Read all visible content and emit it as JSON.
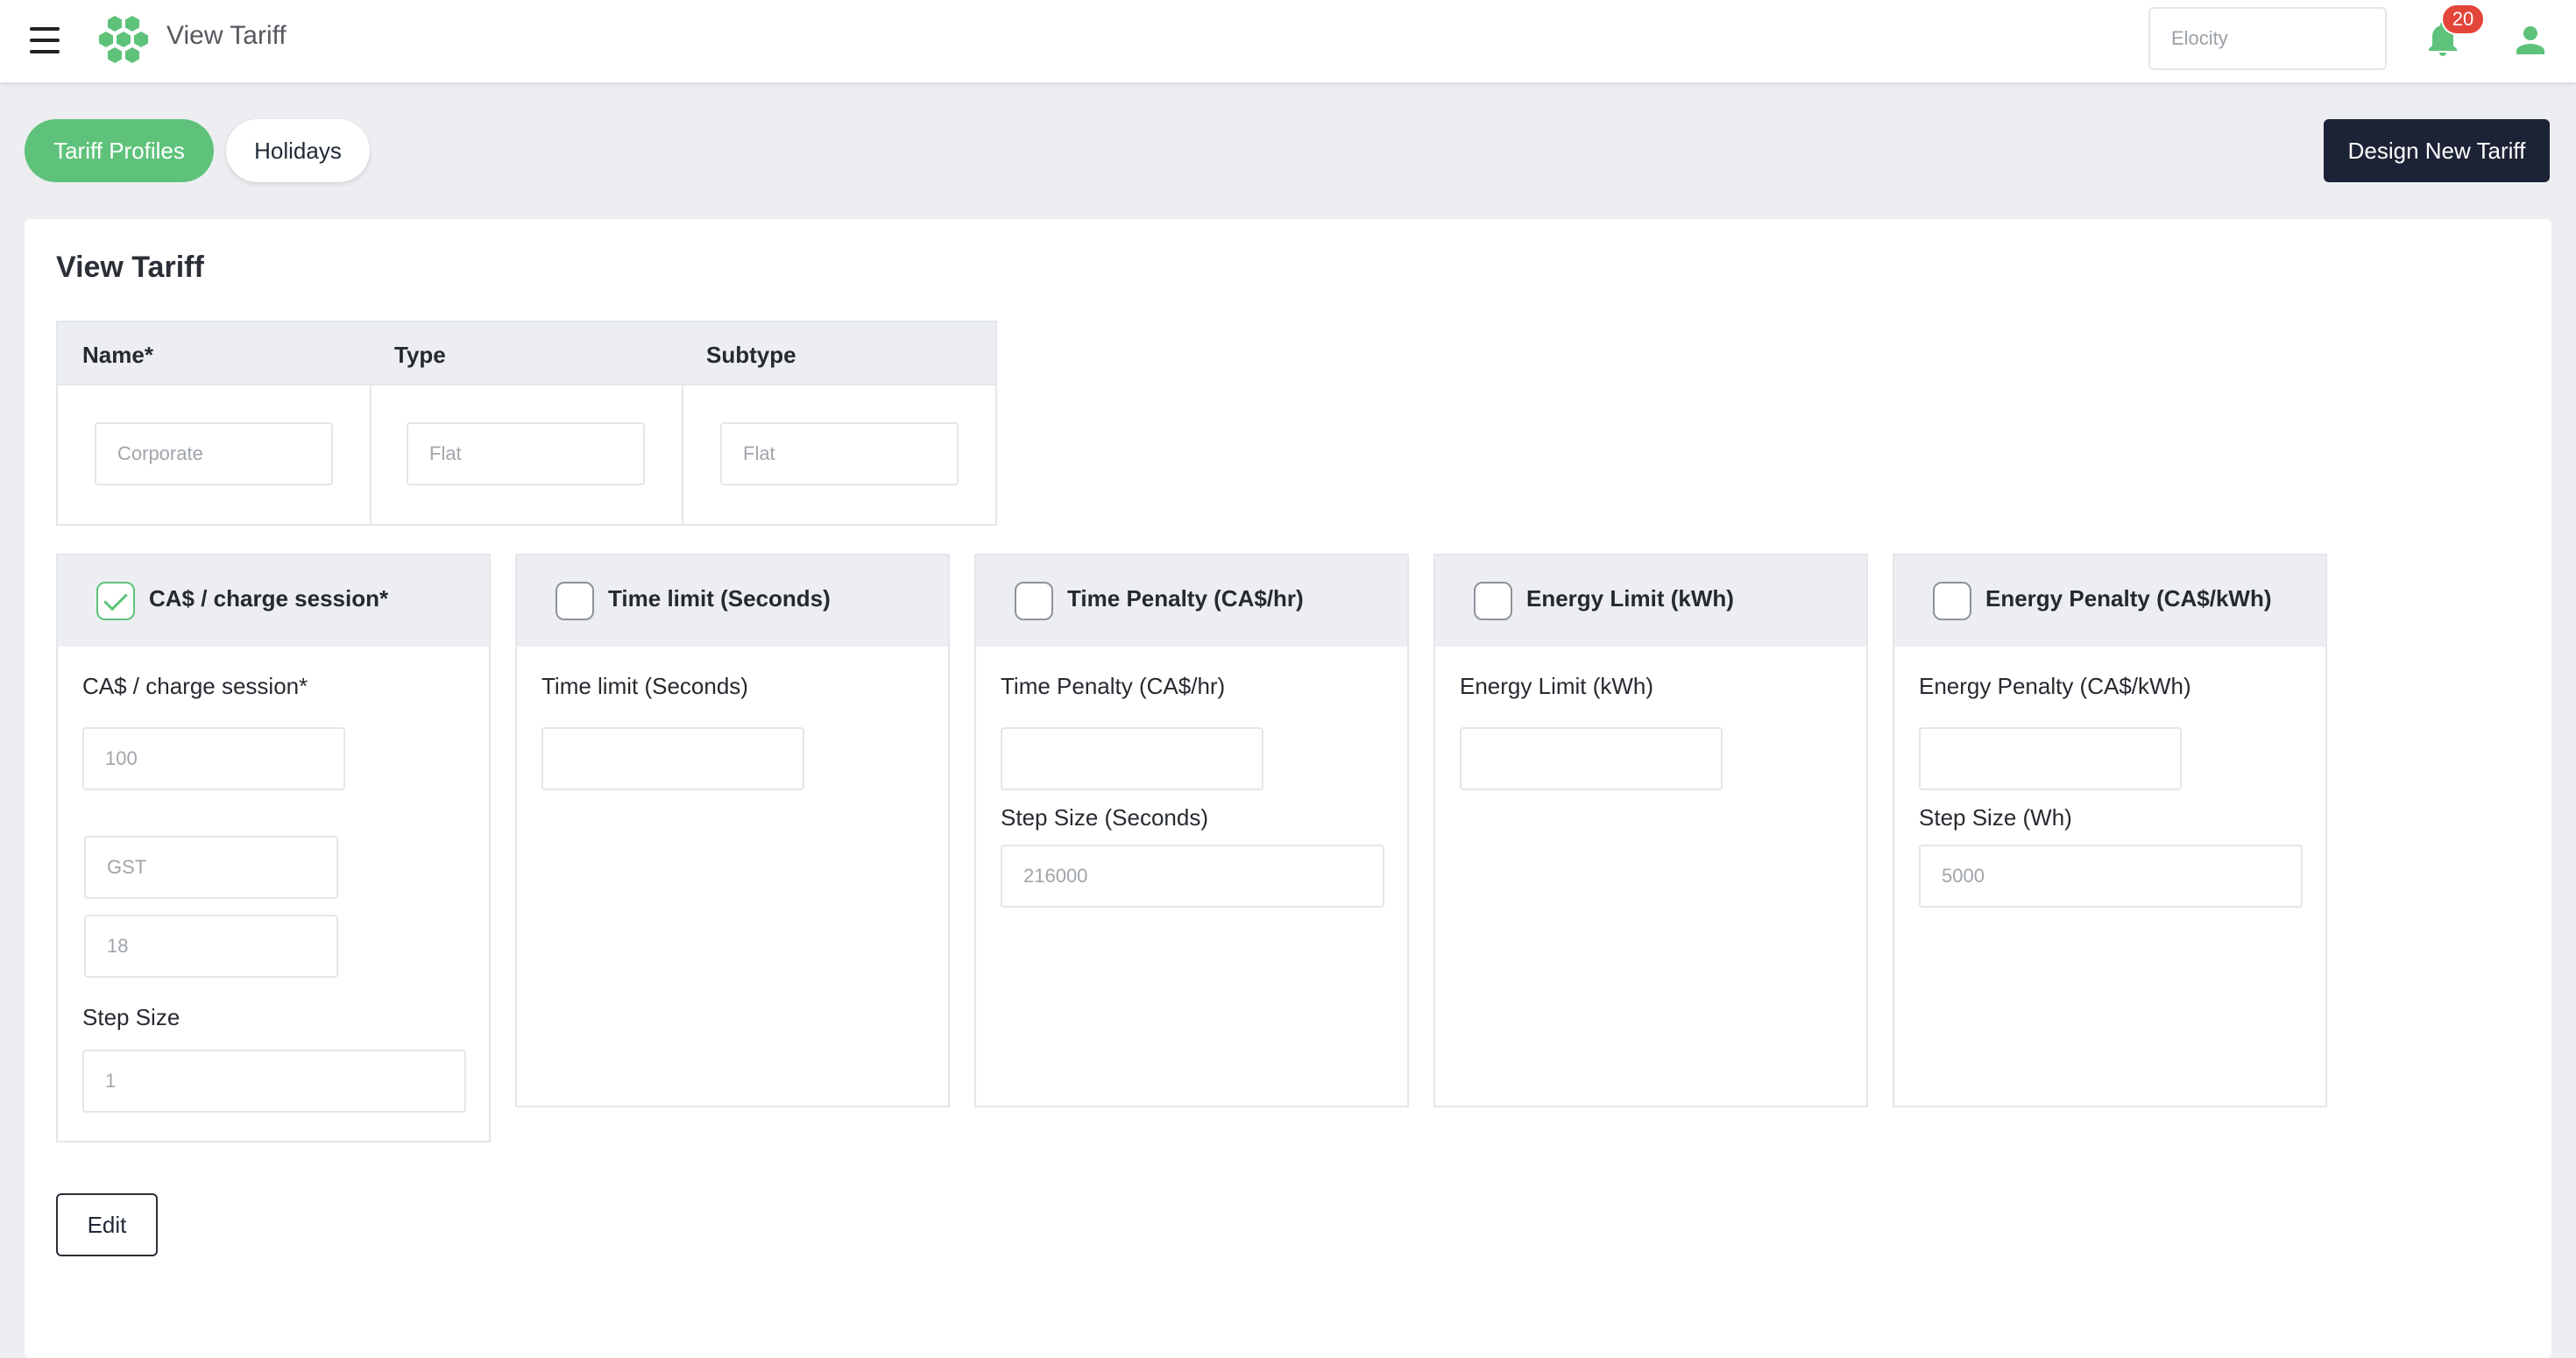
{
  "header": {
    "title": "View Tariff",
    "org_placeholder": "Elocity",
    "notification_count": "20",
    "icons": [
      "menu-icon",
      "logo-icon",
      "bell-icon",
      "user-icon"
    ],
    "accent_color": "#5ec27a"
  },
  "tabs": [
    {
      "label": "Tariff Profiles",
      "active": true
    },
    {
      "label": "Holidays",
      "active": false
    }
  ],
  "design_button": "Design New Tariff",
  "page": {
    "title": "View Tariff",
    "info_table": {
      "headers": [
        "Name*",
        "Type",
        "Subtype"
      ],
      "values": [
        "Corporate",
        "Flat",
        "Flat"
      ]
    },
    "panels": [
      {
        "title": "CA$ / charge session*",
        "checked": true,
        "label": "CA$ / charge session*",
        "value": "100",
        "tax_name": "GST",
        "tax_rate": "18",
        "step_label": "Step Size",
        "step_value": "1"
      },
      {
        "title": "Time limit (Seconds)",
        "checked": false,
        "label": "Time limit (Seconds)",
        "value": ""
      },
      {
        "title": "Time Penalty (CA$/hr)",
        "checked": false,
        "label": "Time Penalty (CA$/hr)",
        "value": "",
        "step_label": "Step Size (Seconds)",
        "step_value": "216000"
      },
      {
        "title": "Energy Limit (kWh)",
        "checked": false,
        "label": "Energy Limit (kWh)",
        "value": ""
      },
      {
        "title": "Energy Penalty (CA$/kWh)",
        "checked": false,
        "label": "Energy Penalty (CA$/kWh)",
        "value": "",
        "step_label": "Step Size (Wh)",
        "step_value": "5000"
      }
    ],
    "edit_button": "Edit"
  }
}
